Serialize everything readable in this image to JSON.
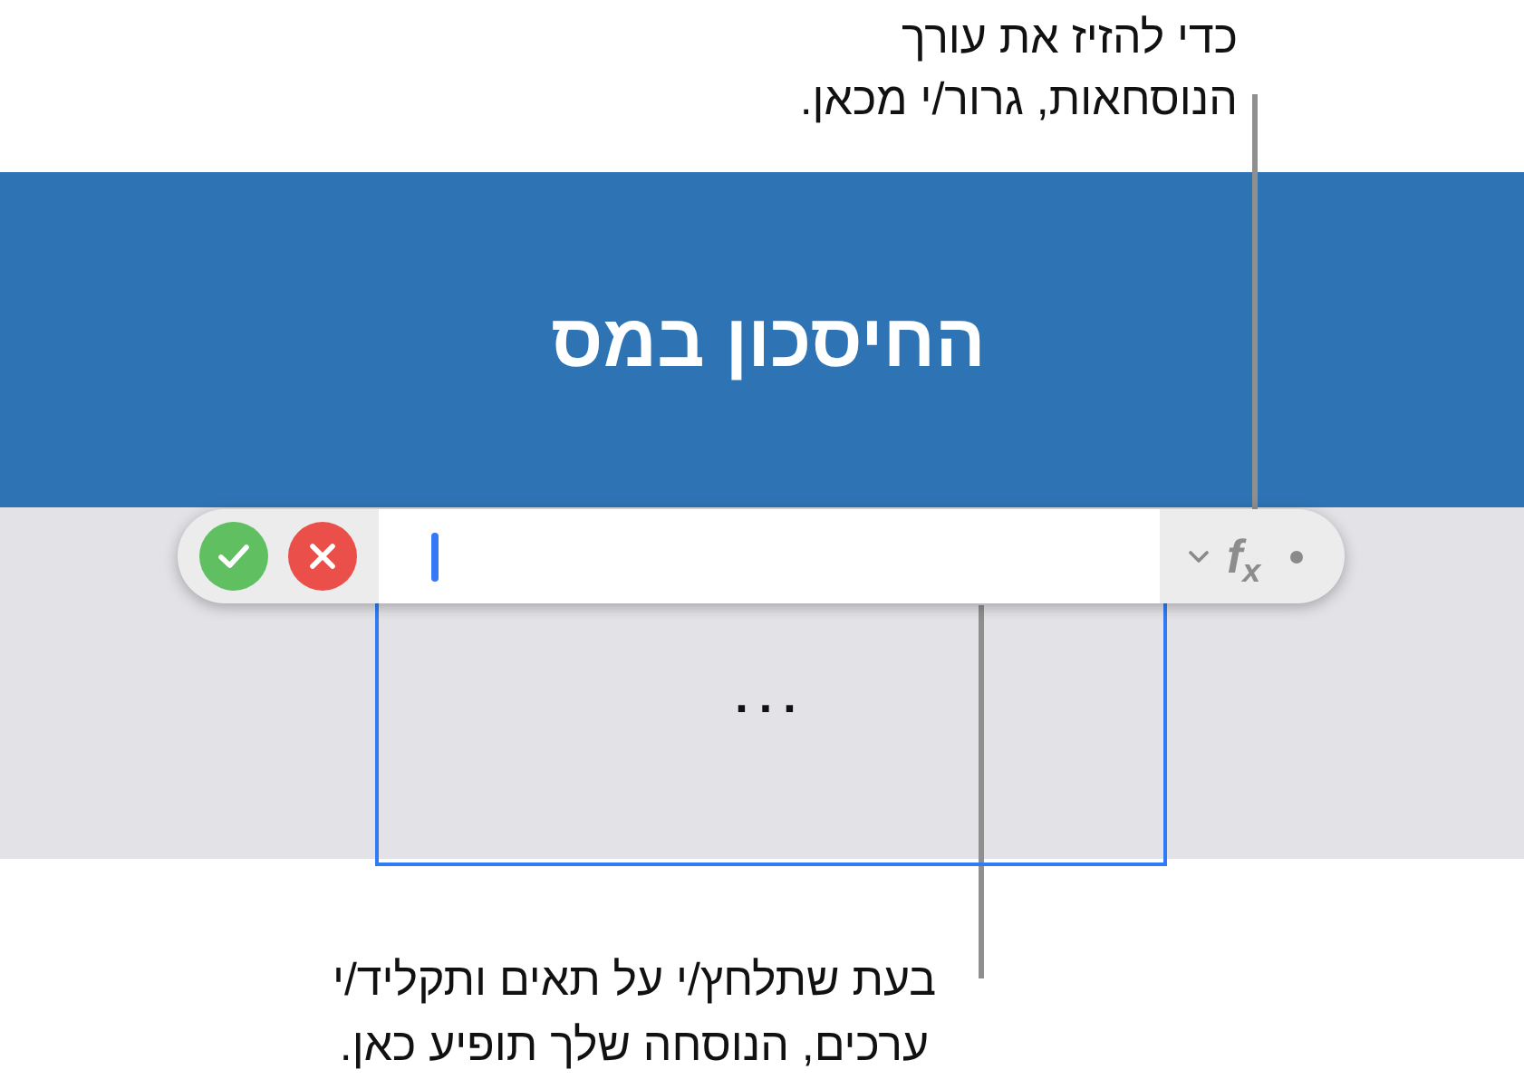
{
  "top_callout": {
    "text": "כדי להזיז את עורך\nהנוסחאות, גרור/י מכאן."
  },
  "table": {
    "title": "החיסכון במס"
  },
  "formula_editor": {
    "input": {
      "focused": true
    },
    "function_label": "f$_{x}$"
  },
  "cell": {
    "value": "...",
    "selected": true
  },
  "bottom_callout": {
    "text": "בעת שתלחץ/י על תאים ותקליד/י\nערכים, הנוסחה שלך תופיע כאן."
  }
}
